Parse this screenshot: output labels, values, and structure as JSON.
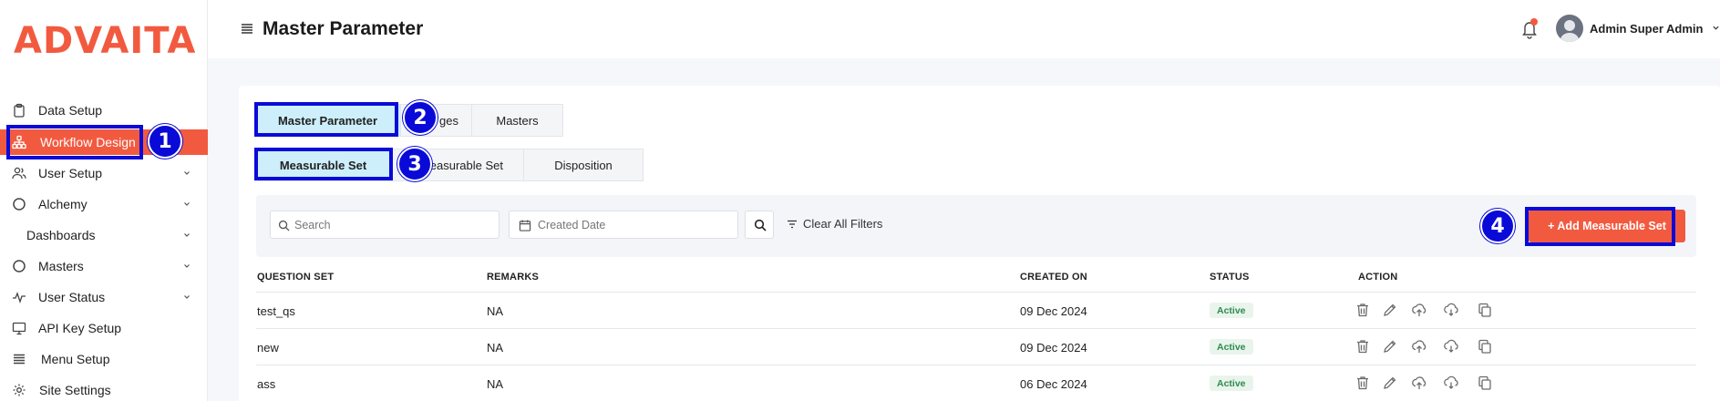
{
  "brand": {
    "logo": "ADVAITA",
    "accent": "#f25a40"
  },
  "sidebar": {
    "items": [
      {
        "label": "Data Setup",
        "icon": "clipboard-icon",
        "chevron": false,
        "active": false
      },
      {
        "label": "Workflow Design",
        "icon": "workflow-icon",
        "chevron": false,
        "active": true
      },
      {
        "label": "User Setup",
        "icon": "users-icon",
        "chevron": true,
        "active": false
      },
      {
        "label": "Alchemy",
        "icon": "circle-icon",
        "chevron": true,
        "active": false
      },
      {
        "label": "Dashboards",
        "icon": "",
        "chevron": true,
        "active": false
      },
      {
        "label": "Masters",
        "icon": "circle-icon",
        "chevron": true,
        "active": false
      },
      {
        "label": "User Status",
        "icon": "activity-icon",
        "chevron": true,
        "active": false
      },
      {
        "label": "API Key Setup",
        "icon": "api-icon",
        "chevron": false,
        "active": false
      },
      {
        "label": "Menu Setup",
        "icon": "menu-lines-icon",
        "chevron": false,
        "active": false
      },
      {
        "label": "Site Settings",
        "icon": "gear-icon",
        "chevron": false,
        "active": false
      }
    ]
  },
  "header": {
    "title": "Master Parameter",
    "user_name": "Admin Super Admin"
  },
  "tabs_primary": [
    {
      "label": "Master Parameter",
      "active": true
    },
    {
      "label": "ges",
      "active": false
    },
    {
      "label": "Masters",
      "active": false
    }
  ],
  "tabs_secondary": [
    {
      "label": "Measurable Set",
      "active": true
    },
    {
      "label": "Measurable Set",
      "active": false
    },
    {
      "label": "Disposition",
      "active": false
    }
  ],
  "filters": {
    "search_placeholder": "Search",
    "date_placeholder": "Created Date",
    "clear_label": "Clear All Filters",
    "add_label": "+ Add Measurable Set"
  },
  "table": {
    "columns": [
      "QUESTION SET",
      "REMARKS",
      "CREATED ON",
      "STATUS",
      "ACTION"
    ],
    "rows": [
      {
        "question_set": "test_qs",
        "remarks": "NA",
        "created_on": "09 Dec 2024",
        "status": "Active"
      },
      {
        "question_set": "new",
        "remarks": "NA",
        "created_on": "09 Dec 2024",
        "status": "Active"
      },
      {
        "question_set": "ass",
        "remarks": "NA",
        "created_on": "06 Dec 2024",
        "status": "Active"
      }
    ],
    "actions": [
      "trash-icon",
      "edit-icon",
      "upload-icon",
      "cloud-upload-icon",
      "copy-icon"
    ]
  },
  "annotations": [
    "1",
    "2",
    "3",
    "4"
  ]
}
